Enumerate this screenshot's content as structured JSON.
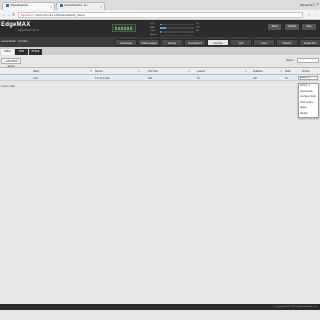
{
  "browser": {
    "tabs": [
      {
        "label": "UbiquitiEdgeMax",
        "active": true
      },
      {
        "label": "UbiquitiNetworks - Di...",
        "active": false
      }
    ],
    "user": "Benjamin",
    "window_controls": "– ▢ ✕",
    "url_warning": "Not secure",
    "url": "https://172.16.1.1/#Services/DHCP_Server"
  },
  "header": {
    "logo": "EdgeMAX",
    "product": "EdgeRouter Pro 8",
    "stats": [
      {
        "label": "CPU",
        "value": "1%",
        "fill": 0.05
      },
      {
        "label": "RAM",
        "value": "17%",
        "fill": 0.17
      },
      {
        "label": "Traffic",
        "value": "0%",
        "fill": 0.02
      },
      {
        "label": "Uptime",
        "value": "",
        "fill": 0.0
      }
    ],
    "alerts_label": "Alerts",
    "wizard_label": "Wizards",
    "help_label": "Help"
  },
  "nav": {
    "left_text": "Global Mode  ·  Invisible",
    "tabs": [
      "Dashboard",
      "Traffic Analysis",
      "Routing",
      "Security/NAT",
      "Services",
      "QoS",
      "Users",
      "Wizards",
      "Config Tree"
    ],
    "active": "Services"
  },
  "subtabs": [
    {
      "label": "DHCP Server",
      "active": true
    },
    {
      "label": "DNS",
      "active": false
    },
    {
      "label": "PPPoE",
      "active": false
    }
  ],
  "toolbar": {
    "add_label": "+ Add DHCP Server",
    "search_label": "Search:",
    "search_value": ""
  },
  "table": {
    "headers": [
      "Name",
      "Subnet",
      "Pool Size",
      "Leased",
      "Available",
      "Static",
      "Actions"
    ],
    "rows": [
      {
        "name": "LAN",
        "subnet": "172.16.1.0/24",
        "pool": "150",
        "leased": "10",
        "available": "140",
        "static": "16",
        "actions": "Actions ▼"
      }
    ],
    "row_count": "1 row in total"
  },
  "dropdown": {
    "items": [
      "Actions ▼",
      "View Details",
      "Configure Static",
      "View Leases",
      "Delete",
      "Disable"
    ]
  },
  "footer": {
    "text": "© Copyright 2012-2017 Ubiquiti Networks, Inc."
  },
  "colors": {
    "header_bg": "#2b2b2b",
    "nav_bg": "#3c3c3c",
    "accent": "#3fb944",
    "row_highlight": "#e2ecf6"
  }
}
